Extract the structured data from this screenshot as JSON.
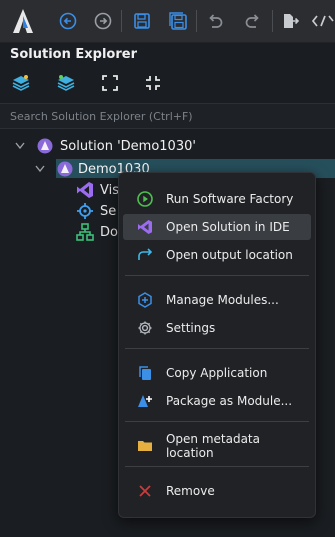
{
  "panel": {
    "title": "Solution Explorer",
    "search_placeholder": "Search Solution Explorer (Ctrl+F)"
  },
  "tree": {
    "solution_label": "Solution 'Demo1030'",
    "project_label": "Demo1030",
    "children": [
      "Vis",
      "Se",
      "Do"
    ]
  },
  "context_menu": {
    "items": [
      {
        "label": "Run Software Factory",
        "icon": "play-icon"
      },
      {
        "label": "Open Solution in IDE",
        "icon": "visual-studio-icon"
      },
      {
        "label": "Open output location",
        "icon": "redirect-arrow-icon"
      },
      {
        "label": "Manage Modules...",
        "icon": "modules-icon"
      },
      {
        "label": "Settings",
        "icon": "gear-icon"
      },
      {
        "label": "Copy Application",
        "icon": "copy-icon"
      },
      {
        "label": "Package as Module...",
        "icon": "package-icon"
      },
      {
        "label": "Open metadata location",
        "icon": "folder-icon"
      },
      {
        "label": "Remove",
        "icon": "close-icon"
      }
    ]
  },
  "colors": {
    "accent_blue": "#3b8fe6",
    "selection": "#264f5c",
    "remove_red": "#c83c3c"
  }
}
